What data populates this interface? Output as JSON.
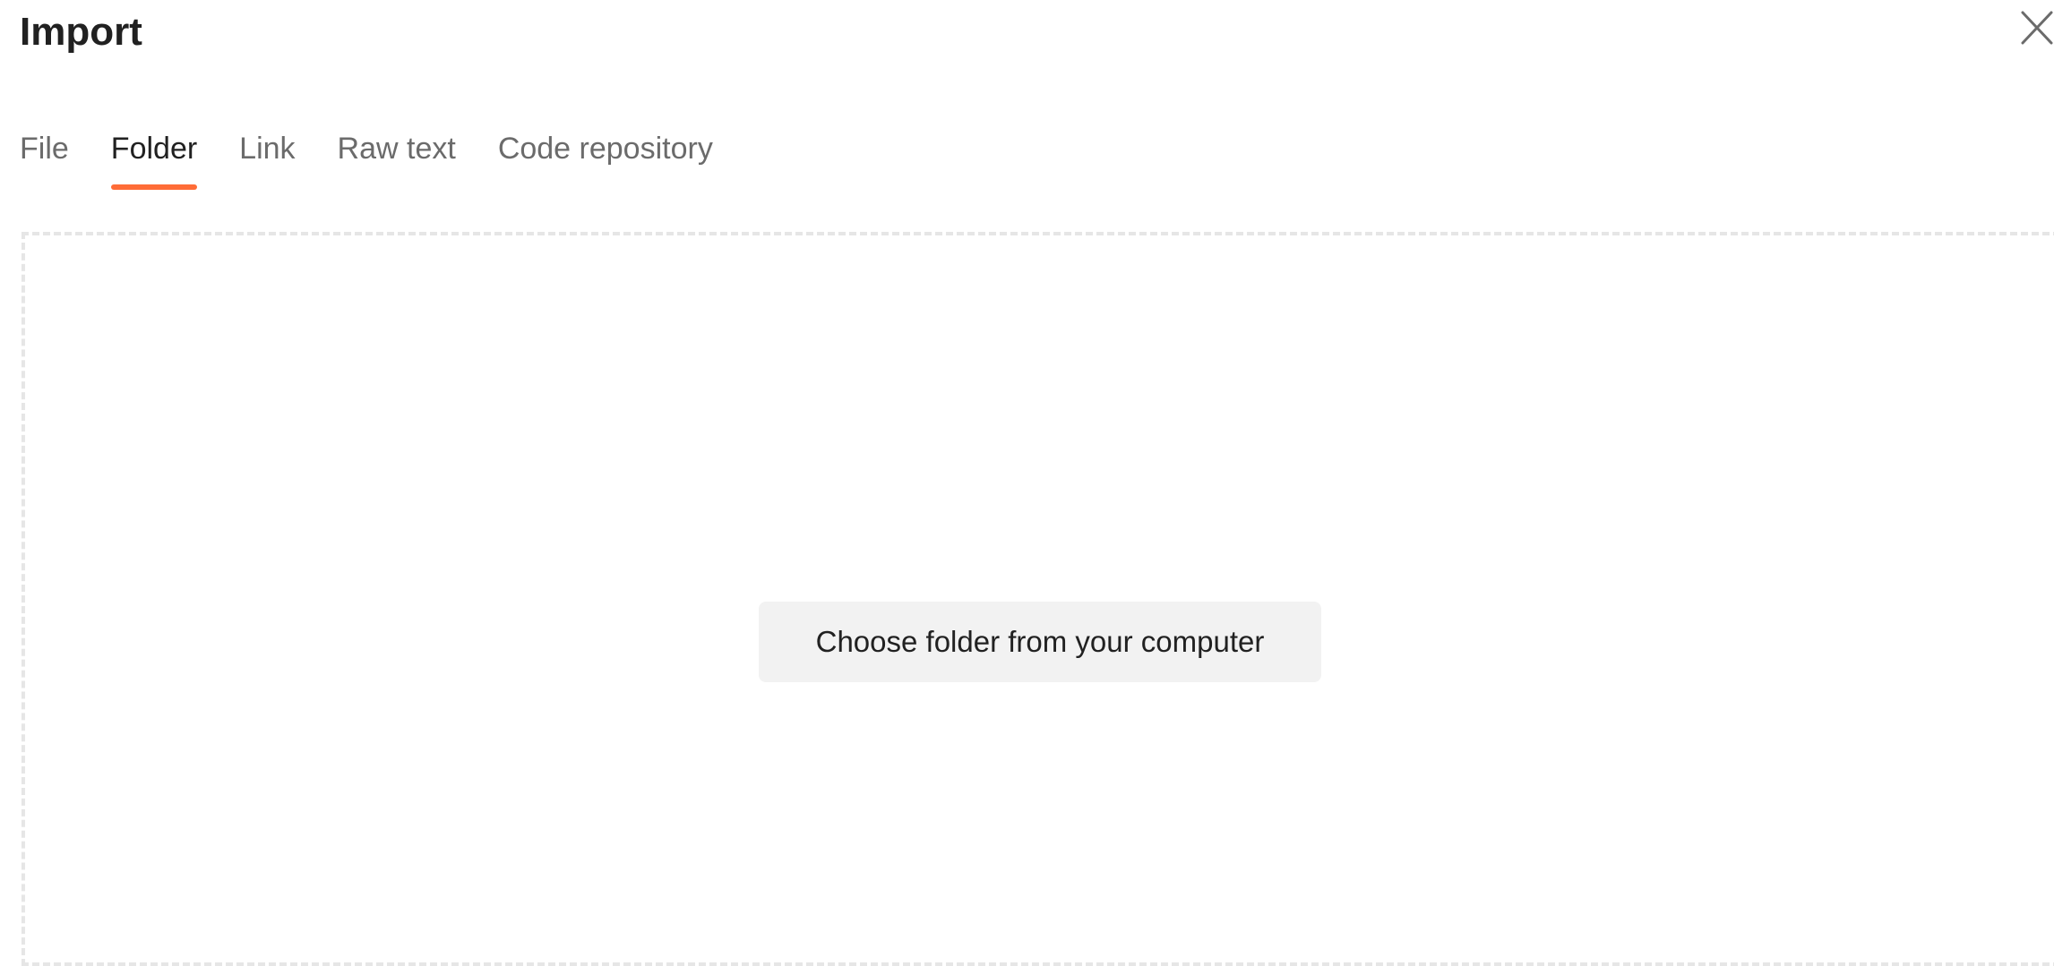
{
  "dialog": {
    "title": "Import",
    "close_icon": "close-icon"
  },
  "tabs": [
    {
      "label": "File",
      "active": false
    },
    {
      "label": "Folder",
      "active": true
    },
    {
      "label": "Link",
      "active": false
    },
    {
      "label": "Raw text",
      "active": false
    },
    {
      "label": "Code repository",
      "active": false
    }
  ],
  "dropzone": {
    "button_label": "Choose folder from your computer"
  },
  "colors": {
    "accent": "#ff6c37",
    "text_primary": "#212121",
    "text_secondary": "#6b6b6b",
    "button_bg": "#f2f2f2",
    "dropzone_border": "#e6e6e6"
  }
}
